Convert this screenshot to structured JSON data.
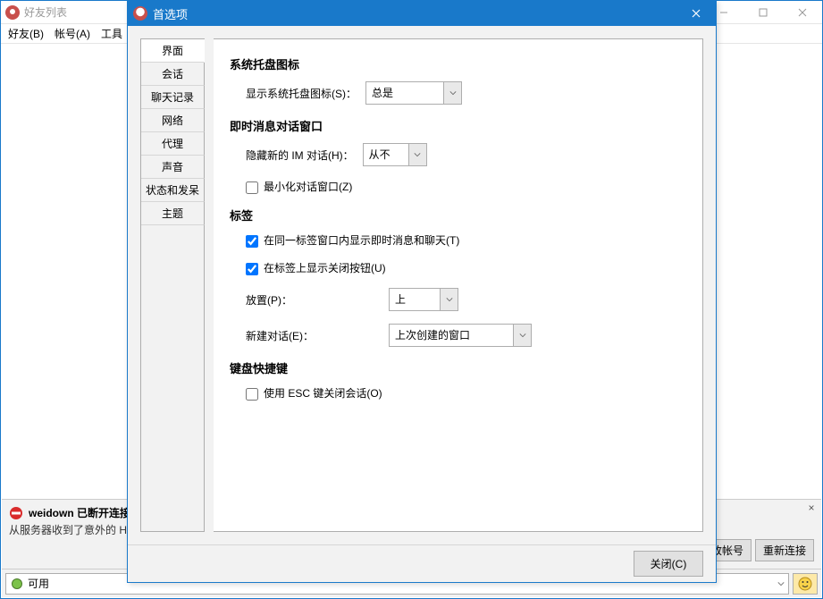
{
  "main": {
    "title": "好友列表",
    "menu": {
      "buddies": "好友(B)",
      "account": "帐号(A)",
      "tools": "工具"
    }
  },
  "error": {
    "title": "weidown 已断开连接",
    "sub": "从服务器收到了意外的 HTTP",
    "modify": "修改帐号",
    "reconnect": "重新连接"
  },
  "status": {
    "text": "可用"
  },
  "prefs": {
    "title": "首选项",
    "tabs": [
      "界面",
      "会话",
      "聊天记录",
      "网络",
      "代理",
      "声音",
      "状态和发呆",
      "主题"
    ],
    "sec_tray": "系统托盘图标",
    "tray_label": "显示系统托盘图标(S)：",
    "tray_value": "总是",
    "sec_im": "即时消息对话窗口",
    "hide_label": "隐藏新的 IM 对话(H)：",
    "hide_value": "从不",
    "min_label": "最小化对话窗口(Z)",
    "sec_tabs": "标签",
    "same_tab": "在同一标签窗口内显示即时消息和聊天(T)",
    "show_close": "在标签上显示关闭按钮(U)",
    "place_label": "放置(P)：",
    "place_value": "上",
    "newconv_label": "新建对话(E)：",
    "newconv_value": "上次创建的窗口",
    "sec_keys": "键盘快捷键",
    "esc_label": "使用 ESC 键关闭会话(O)",
    "close_btn": "关闭(C)"
  }
}
